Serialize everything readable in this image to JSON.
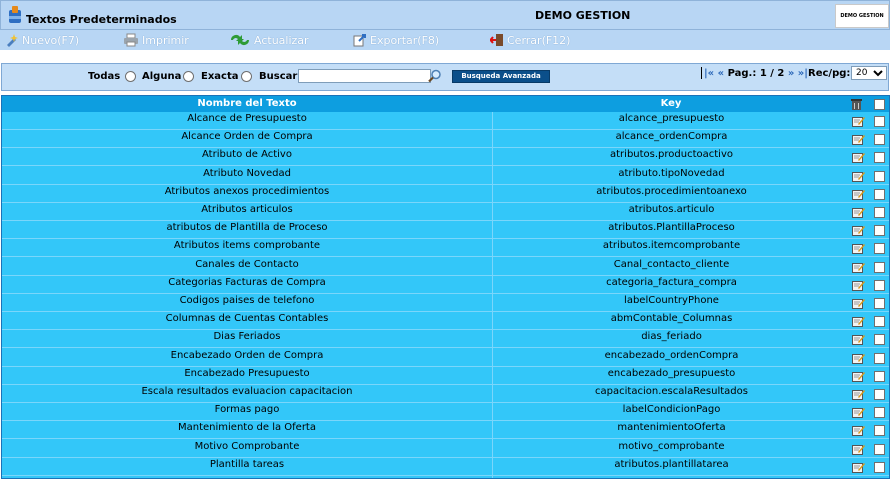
{
  "window": {
    "title": "Textos Predeterminados",
    "company": "DEMO GESTION",
    "brand_logo_text": "DEMO GESTION"
  },
  "toolbar": {
    "nuevo": "Nuevo(F7)",
    "imprimir": "Imprimir",
    "actualizar": "Actualizar",
    "exportar": "Exportar(F8)",
    "cerrar": "Cerrar(F12)"
  },
  "search": {
    "todas": "Todas",
    "alguna": "Alguna",
    "exacta": "Exacta",
    "buscar": "Buscar",
    "value": "",
    "advanced": "Busqueda Avanzada"
  },
  "pager": {
    "first": "|«",
    "prev": "«",
    "label": "Pag.:",
    "current": "1 / 2",
    "next": "»",
    "last": "»|",
    "recpg_label": "Rec/pg:",
    "recpg_value": "20"
  },
  "table": {
    "headers": [
      "Nombre del Texto",
      "Key"
    ],
    "rows": [
      {
        "name": "Alcance de Presupuesto",
        "key": "alcance_presupuesto"
      },
      {
        "name": "Alcance Orden de Compra",
        "key": "alcance_ordenCompra"
      },
      {
        "name": "Atributo de Activo",
        "key": "atributos.productoactivo"
      },
      {
        "name": "Atributo Novedad",
        "key": "atributo.tipoNovedad"
      },
      {
        "name": "Atributos anexos procedimientos",
        "key": "atributos.procedimientoanexo"
      },
      {
        "name": "Atributos articulos",
        "key": "atributos.articulo"
      },
      {
        "name": "atributos de Plantilla de Proceso",
        "key": "atributos.PlantillaProceso"
      },
      {
        "name": "Atributos items comprobante",
        "key": "atributos.itemcomprobante"
      },
      {
        "name": "Canales de Contacto",
        "key": "Canal_contacto_cliente"
      },
      {
        "name": "Categorias Facturas de Compra",
        "key": "categoria_factura_compra"
      },
      {
        "name": "Codigos paises de telefono",
        "key": "labelCountryPhone"
      },
      {
        "name": "Columnas de Cuentas Contables",
        "key": "abmContable_Columnas"
      },
      {
        "name": "Dias Feriados",
        "key": "dias_feriado"
      },
      {
        "name": "Encabezado Orden de Compra",
        "key": "encabezado_ordenCompra"
      },
      {
        "name": "Encabezado Presupuesto",
        "key": "encabezado_presupuesto"
      },
      {
        "name": "Escala resultados evaluacion capacitacion",
        "key": "capacitacion.escalaResultados"
      },
      {
        "name": "Formas pago",
        "key": "labelCondicionPago"
      },
      {
        "name": "Mantenimiento de la Oferta",
        "key": "mantenimientoOferta"
      },
      {
        "name": "Motivo Comprobante",
        "key": "motivo_comprobante"
      },
      {
        "name": "Plantilla tareas",
        "key": "atributos.plantillatarea"
      }
    ]
  }
}
